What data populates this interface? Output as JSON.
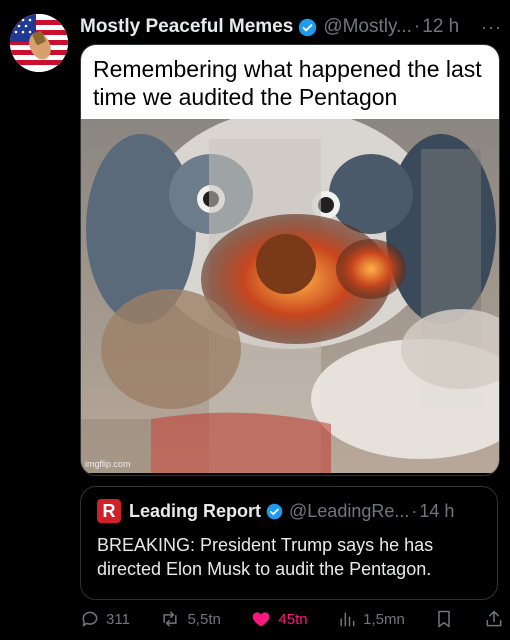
{
  "post": {
    "author_name": "Mostly Peaceful Memes",
    "author_handle": "@Mostly...",
    "separator": "·",
    "time": "12 h",
    "more": "···",
    "caption": "Remembering what happened the last time we audited the Pentagon",
    "watermark": "imgflip.com"
  },
  "quote": {
    "logo_letter": "R",
    "author_name": "Leading Report",
    "author_handle": "@LeadingRe...",
    "separator": "·",
    "time": "14 h",
    "text": "BREAKING: President Trump says he has directed Elon Musk to audit the Pentagon."
  },
  "actions": {
    "replies": "311",
    "reposts": "5,5tn",
    "likes": "45tn",
    "views": "1,5mn"
  },
  "colors": {
    "verified": "#1d9bf0",
    "like": "#f91880",
    "muted": "#71767b",
    "quote_logo": "#d0202a"
  }
}
